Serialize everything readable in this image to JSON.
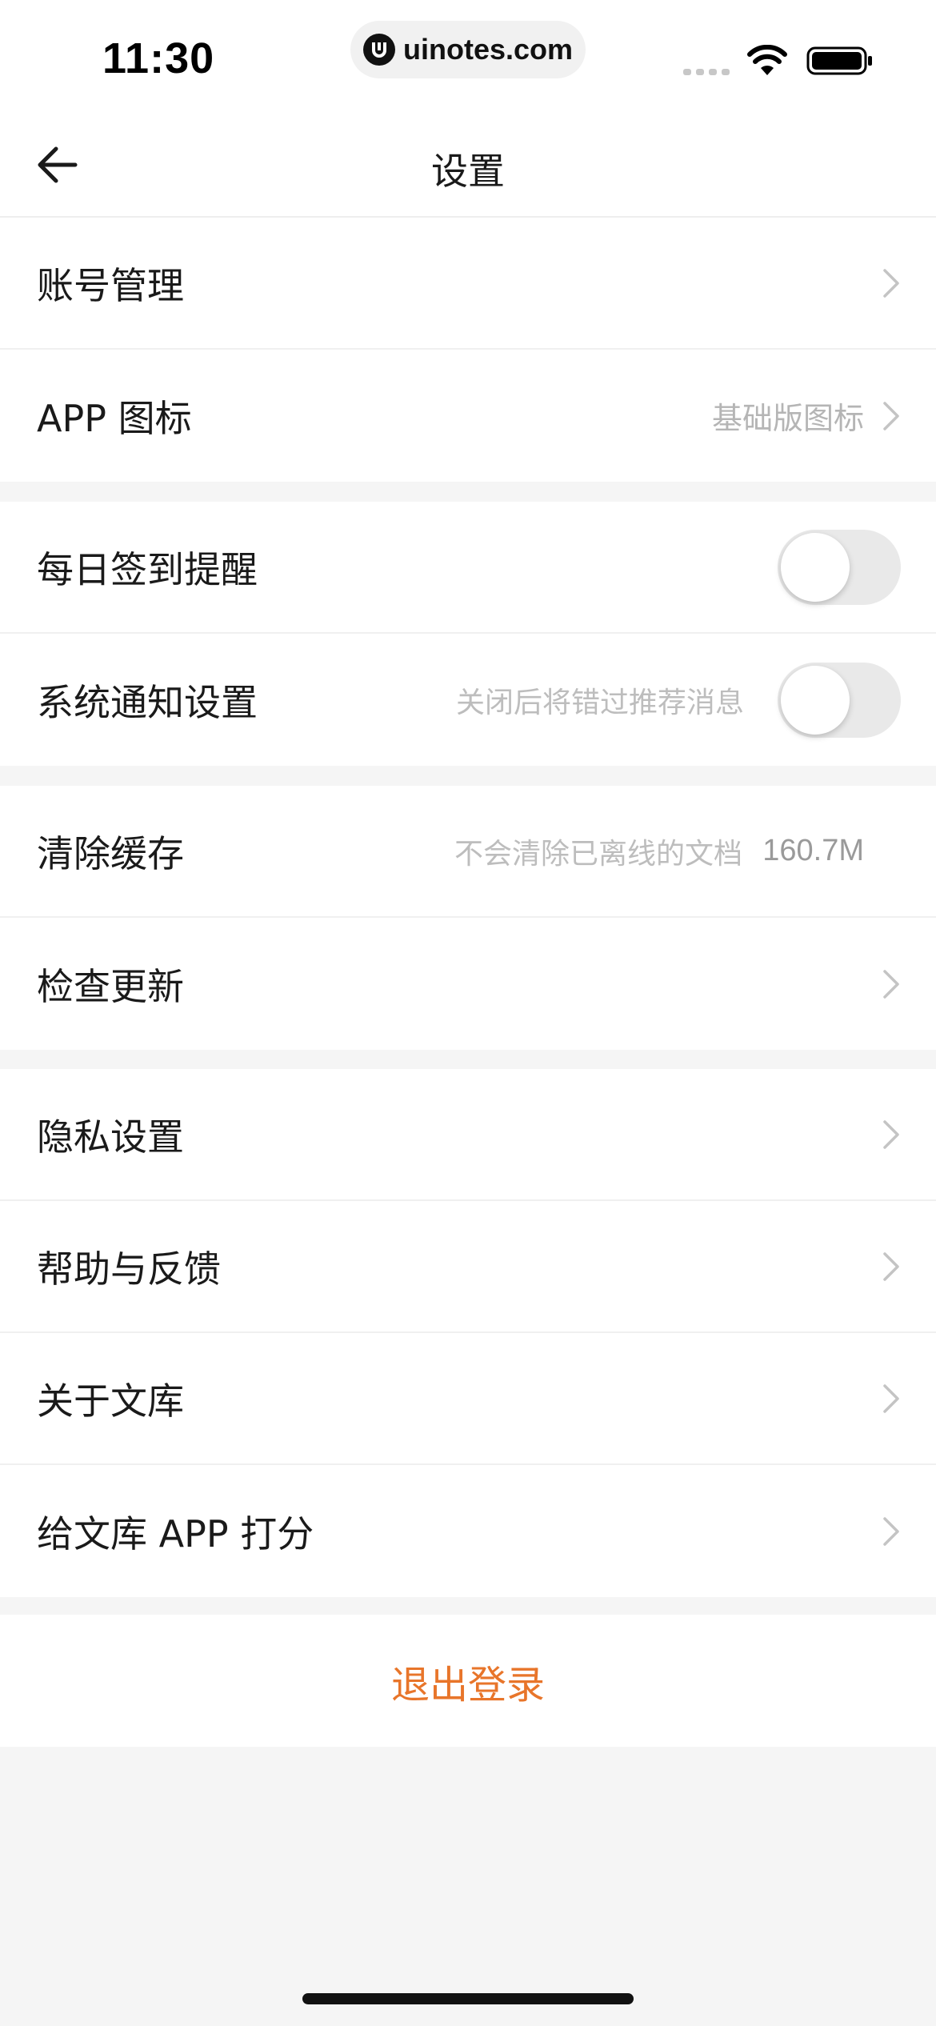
{
  "status_bar": {
    "time": "11:30",
    "url": "uinotes.com"
  },
  "nav": {
    "title": "设置"
  },
  "groups": [
    {
      "rows": [
        {
          "label": "账号管理"
        },
        {
          "label": "APP 图标",
          "value": "基础版图标"
        }
      ]
    },
    {
      "rows": [
        {
          "label": "每日签到提醒",
          "toggle_on": false
        },
        {
          "label": "系统通知设置",
          "hint": "关闭后将错过推荐消息",
          "toggle_on": false
        }
      ]
    },
    {
      "rows": [
        {
          "label": "清除缓存",
          "hint": "不会清除已离线的文档",
          "value": "160.7M"
        },
        {
          "label": "检查更新"
        }
      ]
    },
    {
      "rows": [
        {
          "label": "隐私设置"
        },
        {
          "label": "帮助与反馈"
        },
        {
          "label": "关于文库"
        },
        {
          "label": "给文库 APP 打分"
        }
      ]
    }
  ],
  "logout": {
    "label": "退出登录"
  },
  "colors": {
    "accent": "#e8752a",
    "background": "#f5f5f5",
    "muted_text": "#b5b5b5"
  }
}
